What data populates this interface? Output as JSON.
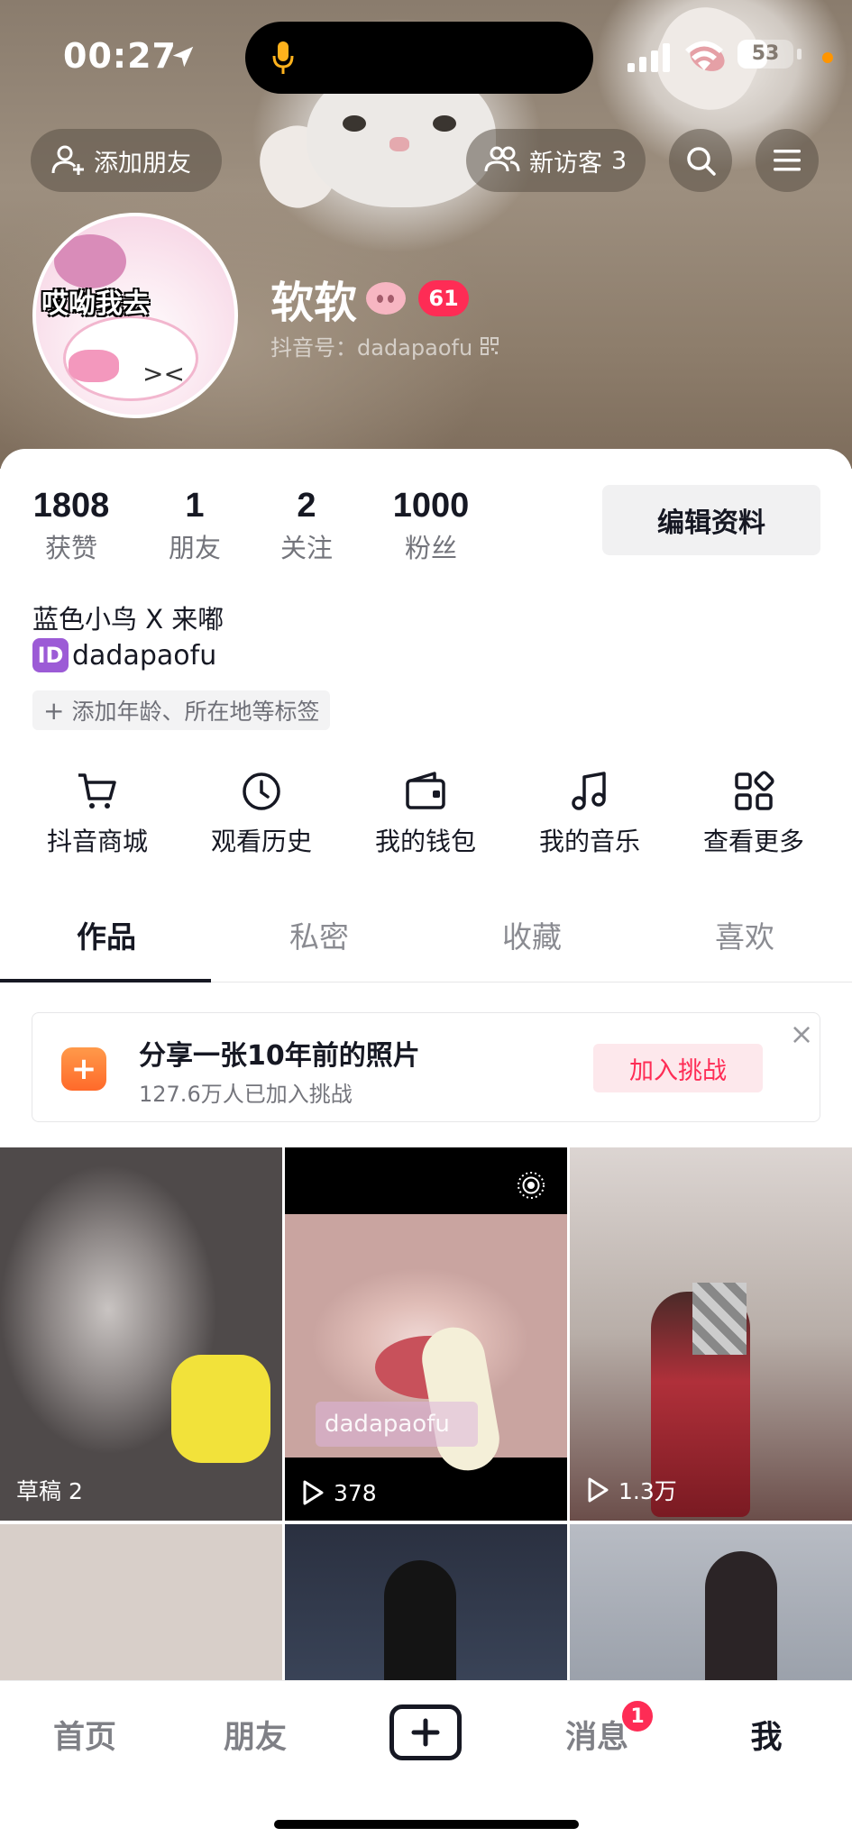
{
  "status_bar": {
    "time": "00:27",
    "battery": "53",
    "battery_level": 0.53
  },
  "header": {
    "add_friend_label": "添加朋友",
    "visitors_label": "新访客",
    "visitors_count": "3",
    "search_icon": "search-icon",
    "menu_icon": "hamburger-menu-icon"
  },
  "profile": {
    "avatar_caption": "哎呦我去",
    "name": "软软",
    "level": "61",
    "douyin_id": "抖音号：dadapaofu",
    "bio": "蓝色小鸟 X 来嘟",
    "id_badge": "ID",
    "id_handle": "dadapaofu",
    "add_tags": "添加年龄、所在地等标签",
    "edit_profile": "编辑资料"
  },
  "stats": [
    {
      "value": "1808",
      "label": "获赞"
    },
    {
      "value": "1",
      "label": "朋友"
    },
    {
      "value": "2",
      "label": "关注"
    },
    {
      "value": "1000",
      "label": "粉丝"
    }
  ],
  "shortcuts": [
    {
      "label": "抖音商城",
      "icon": "cart-icon"
    },
    {
      "label": "观看历史",
      "icon": "clock-icon"
    },
    {
      "label": "我的钱包",
      "icon": "wallet-icon"
    },
    {
      "label": "我的音乐",
      "icon": "music-note-icon"
    },
    {
      "label": "查看更多",
      "icon": "grid-more-icon"
    }
  ],
  "tabs": [
    {
      "label": "作品",
      "active": true
    },
    {
      "label": "私密",
      "active": false
    },
    {
      "label": "收藏",
      "active": false
    },
    {
      "label": "喜欢",
      "active": false
    }
  ],
  "challenge": {
    "title": "分享一张10年前的照片",
    "subtitle": "127.6万人已加入挑战",
    "join_label": "加入挑战"
  },
  "videos": [
    {
      "label": "草稿 2",
      "type": "draft"
    },
    {
      "label": "378",
      "type": "play",
      "watermark": "dadapaofu"
    },
    {
      "label": "1.3万",
      "type": "play"
    },
    {
      "label": "",
      "type": "none"
    },
    {
      "label": "",
      "type": "none"
    },
    {
      "label": "",
      "type": "none"
    }
  ],
  "bottom_nav": {
    "home": "首页",
    "friends": "朋友",
    "messages": "消息",
    "messages_badge": "1",
    "me": "我"
  },
  "colors": {
    "accent": "#fe2c55",
    "text": "#161823",
    "id_badge": "#9c5bd6",
    "challenge_icon": "#ff7a2f"
  }
}
